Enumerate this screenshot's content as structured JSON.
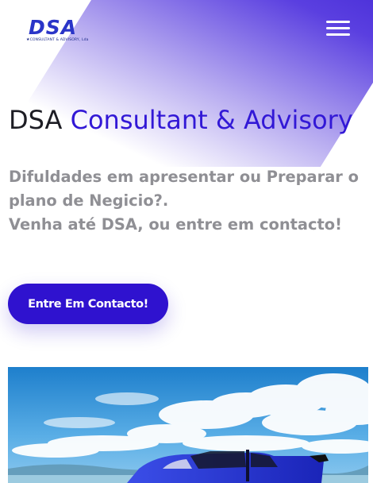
{
  "header": {
    "logo": {
      "mark": "DSA",
      "subtitle": "CONSULTANT & ADVISORY, Lda"
    },
    "menu_icon": "hamburger-menu-icon"
  },
  "hero": {
    "title_part1": "DSA",
    "title_part2": "Consultant & Advisory",
    "text_line1": "Difuldades em apresentar ou Preparar o",
    "text_line2": "plano de Negicio?.",
    "text_line3": "Venha até DSA, ou entre em contacto!",
    "cta_label": "Entre Em Contacto!"
  },
  "colors": {
    "accent": "#3218d6",
    "button": "#2f12cf",
    "body_text": "#8f8f94",
    "title_text": "#1d1d24"
  }
}
